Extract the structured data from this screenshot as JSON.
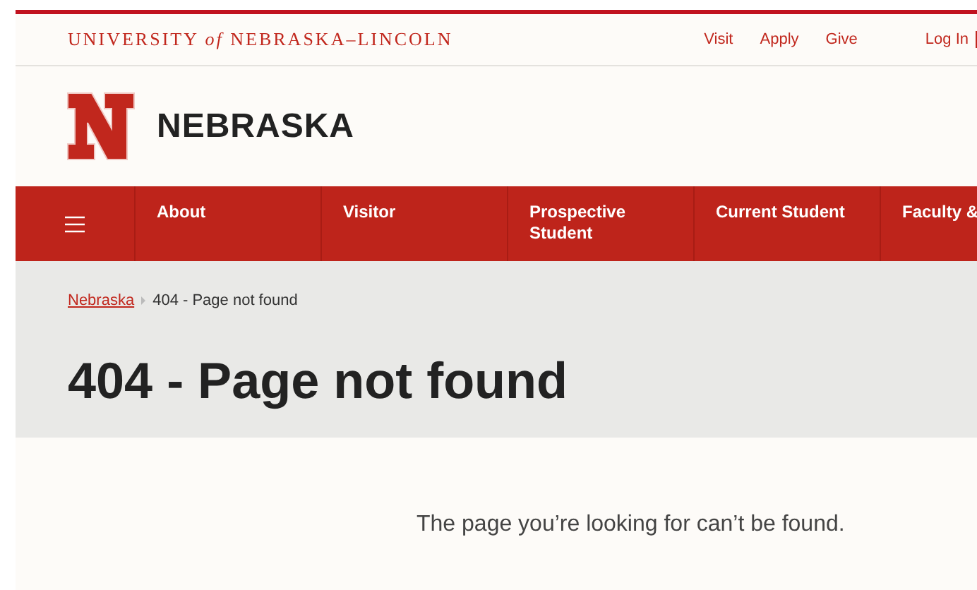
{
  "header": {
    "university": "UNIVERSITY *of* NEBRASKA–LINCOLN",
    "links": [
      "Visit",
      "Apply",
      "Give"
    ],
    "login": "Log In"
  },
  "brand": {
    "name": "NEBRASKA"
  },
  "nav": {
    "items": [
      {
        "label": "About"
      },
      {
        "label": "Visitor"
      },
      {
        "label": "Prospective Student"
      },
      {
        "label": "Current Student"
      },
      {
        "label": "Faculty &"
      }
    ]
  },
  "breadcrumbs": [
    {
      "label": "Nebraska",
      "link": true
    },
    {
      "label": "404 - Page not found",
      "link": false
    }
  ],
  "page": {
    "title": "404 - Page not found",
    "message": "The page you’re looking for can’t be found."
  }
}
